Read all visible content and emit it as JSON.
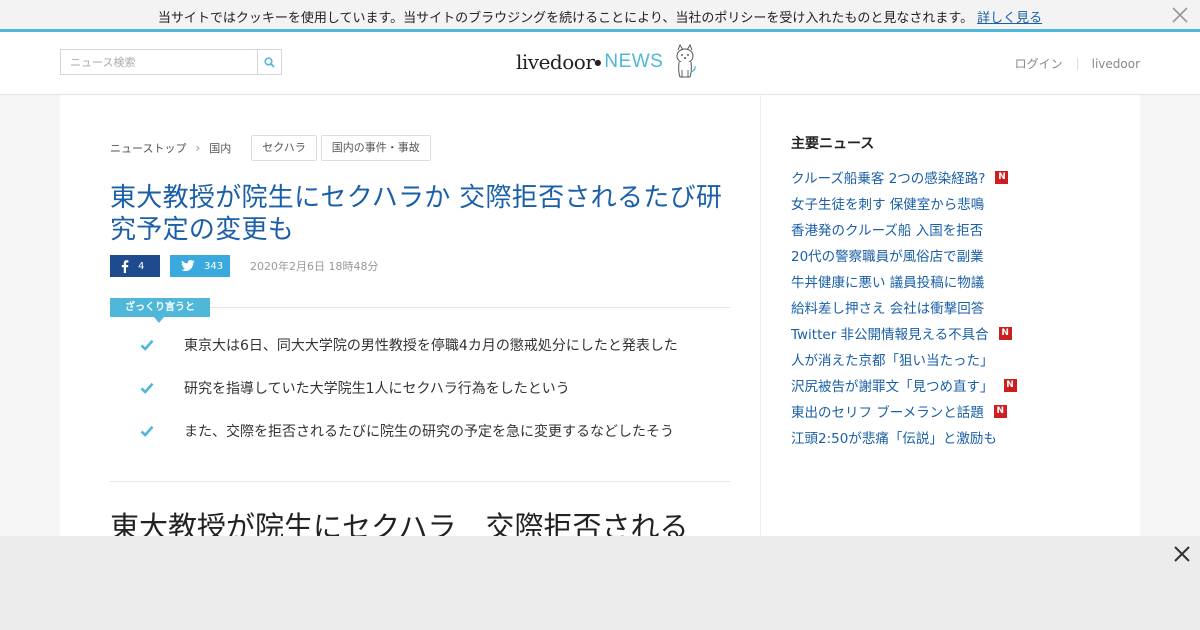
{
  "cookie_bar": {
    "text": "当サイトではクッキーを使用しています。当サイトのブラウジングを続けることにより、当社のポリシーを受け入れたものと見なされます。",
    "link_label": "詳しく見る",
    "close_icon": "close-icon"
  },
  "header": {
    "search_placeholder": "ニュース検索",
    "search_icon": "search-icon",
    "logo_livedoor": "livedoor",
    "logo_news": "NEWS",
    "logo_mascot_icon": "dog-mascot-icon",
    "nav": {
      "login": "ログイン",
      "livedoor": "livedoor"
    }
  },
  "article": {
    "breadcrumb": {
      "top": "ニューストップ",
      "category": "国内",
      "separator": "›"
    },
    "tags": [
      "セクハラ",
      "国内の事件・事故"
    ],
    "title": "東大教授が院生にセクハラか 交際拒否されるたび研究予定の変更も",
    "share": {
      "facebook_count": "4",
      "twitter_count": "343"
    },
    "date": "2020年2月6日 18時48分",
    "summary_label": "ざっくり言うと",
    "summary": [
      "東京大は6日、同大大学院の男性教授を停職4カ月の懲戒処分にしたと発表した",
      "研究を指導していた大学院生1人にセクハラ行為をしたという",
      "また、交際を拒否されるたびに院生の研究の予定を急に変更するなどしたそう"
    ],
    "body_heading": "東大教授が院生にセクハラ　交際拒否される"
  },
  "sidebar": {
    "title": "主要ニュース",
    "new_badge": "N",
    "items": [
      {
        "label": "クルーズ船乗客 2つの感染経路?",
        "is_new": true
      },
      {
        "label": "女子生徒を刺す 保健室から悲鳴",
        "is_new": false
      },
      {
        "label": "香港発のクルーズ船 入国を拒否",
        "is_new": false
      },
      {
        "label": "20代の警察職員が風俗店で副業",
        "is_new": false
      },
      {
        "label": "牛丼健康に悪い 議員投稿に物議",
        "is_new": false
      },
      {
        "label": "給料差し押さえ 会社は衝撃回答",
        "is_new": false
      },
      {
        "label": "Twitter 非公開情報見える不具合",
        "is_new": true
      },
      {
        "label": "人が消えた京都「狙い当たった」",
        "is_new": false
      },
      {
        "label": "沢尻被告が謝罪文「見つめ直す」",
        "is_new": true
      },
      {
        "label": "東出のセリフ ブーメランと話題",
        "is_new": true
      },
      {
        "label": "江頭2:50が悲痛「伝説」と激励も",
        "is_new": false
      }
    ]
  },
  "colors": {
    "accent": "#4fb7d9",
    "link": "#1a5fa8",
    "facebook": "#1e4b8e",
    "twitter": "#3aa9dd",
    "new_badge": "#cc1f1f"
  }
}
